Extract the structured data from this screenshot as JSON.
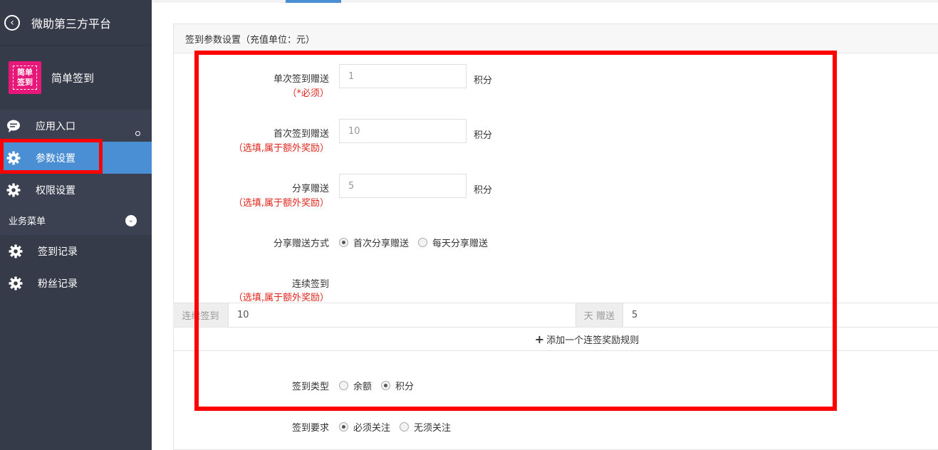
{
  "sidebar": {
    "platform_name": "微助第三方平台",
    "app_logo_text": "简单\n签到",
    "app_name": "简单签到",
    "items": [
      {
        "label": "应用入口"
      },
      {
        "label": "参数设置"
      },
      {
        "label": "权限设置"
      }
    ],
    "biz_header": "业务菜单",
    "biz_items": [
      {
        "label": "签到记录"
      },
      {
        "label": "粉丝记录"
      }
    ]
  },
  "panel": {
    "title": "签到参数设置（充值单位：元）"
  },
  "form": {
    "single": {
      "label": "单次签到赠送",
      "note": "（*必须）",
      "value": "1",
      "unit": "积分"
    },
    "first": {
      "label": "首次签到赠送",
      "note": "（选填,属于额外奖励）",
      "value": "10",
      "unit": "积分"
    },
    "share": {
      "label": "分享赠送",
      "note": "（选填,属于额外奖励）",
      "value": "5",
      "unit": "积分"
    },
    "share_mode": {
      "label": "分享赠送方式",
      "options": [
        "首次分享赠送",
        "每天分享赠送"
      ],
      "selected": 0
    },
    "continuous": {
      "label": "连续签到",
      "note": "（选填,属于额外奖励）"
    },
    "cont_rule": {
      "prefix": "连续签到",
      "days": "10",
      "mid": "天 赠送",
      "reward": "5"
    },
    "add_rule": "添加一个连签奖励规则",
    "sign_type": {
      "label": "签到类型",
      "options": [
        "余额",
        "积分"
      ],
      "selected": 1
    },
    "sign_req": {
      "label": "签到要求",
      "options": [
        "必须关注",
        "无须关注"
      ],
      "selected": 0
    }
  }
}
